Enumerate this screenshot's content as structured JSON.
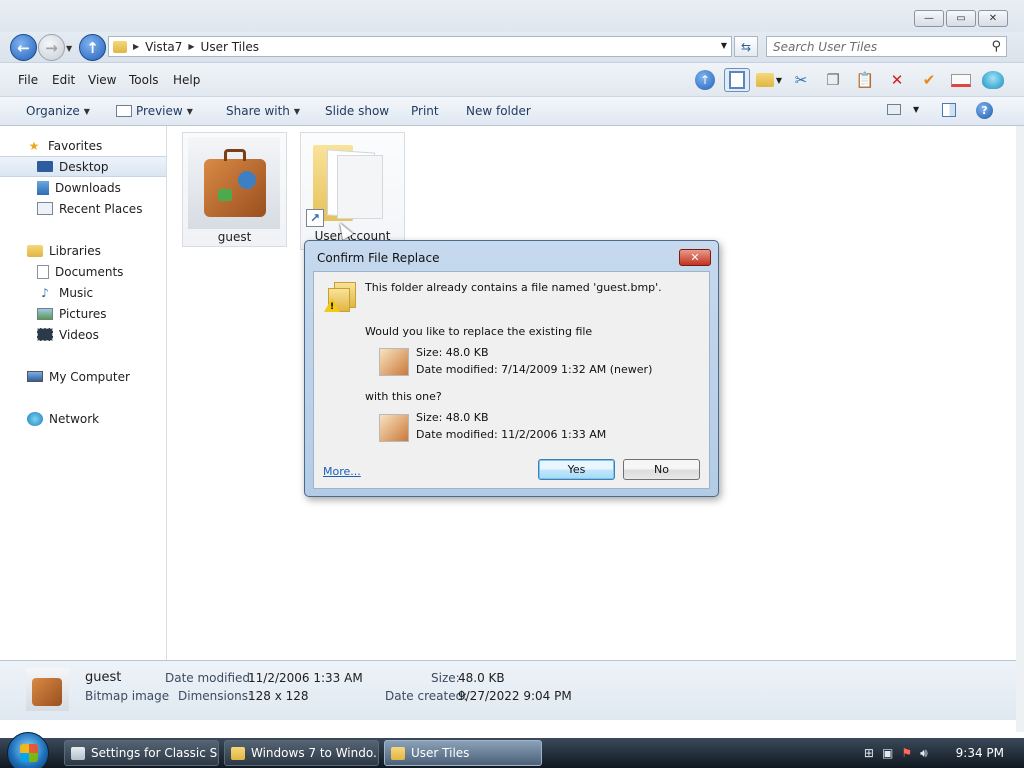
{
  "window": {
    "controls": {
      "minimize": "—",
      "maximize": "▭",
      "close": "✕"
    }
  },
  "address": {
    "crumbs": [
      "Vista7",
      "User Tiles"
    ],
    "search_placeholder": "Search User Tiles"
  },
  "menubar": {
    "items": [
      "File",
      "Edit",
      "View",
      "Tools",
      "Help"
    ]
  },
  "toolbar_icons": [
    "up-arrow-icon",
    "preview-pane-icon",
    "folder-options-icon",
    "cut-icon",
    "copy-icon",
    "paste-icon",
    "delete-icon",
    "check-icon",
    "rename-icon",
    "globe-icon"
  ],
  "commandbar": {
    "organize": "Organize",
    "preview": "Preview",
    "share_with": "Share with",
    "slide_show": "Slide show",
    "print": "Print",
    "new_folder": "New folder"
  },
  "navpane": {
    "favorites": "Favorites",
    "desktop": "Desktop",
    "downloads": "Downloads",
    "recent_places": "Recent Places",
    "libraries": "Libraries",
    "documents": "Documents",
    "music": "Music",
    "pictures": "Pictures",
    "videos": "Videos",
    "my_computer": "My Computer",
    "network": "Network"
  },
  "files": [
    {
      "name": "guest",
      "type": "image"
    },
    {
      "name": "UserAccount",
      "type": "folder-shortcut"
    }
  ],
  "dialog": {
    "title": "Confirm File Replace",
    "message": "This folder already contains a file named 'guest.bmp'.",
    "question": "Would you like to replace the existing file",
    "existing_size": "Size: 48.0 KB",
    "existing_date": "Date modified: 7/14/2009 1:32 AM (newer)",
    "with_label": "with this one?",
    "new_size": "Size: 48.0 KB",
    "new_date": "Date modified: 11/2/2006 1:33 AM",
    "more_link": "More...",
    "yes": "Yes",
    "no": "No"
  },
  "details": {
    "name": "guest",
    "type": "Bitmap image",
    "date_modified_label": "Date modified:",
    "date_modified": "11/2/2006 1:33 AM",
    "dimensions_label": "Dimensions:",
    "dimensions": "128 x 128",
    "size_label": "Size:",
    "size": "48.0 KB",
    "date_created_label": "Date created:",
    "date_created": "9/27/2022 9:04 PM"
  },
  "taskbar": {
    "tasks": [
      "Settings for Classic S...",
      "Windows 7 to Windo...",
      "User Tiles"
    ],
    "clock": "9:34 PM"
  }
}
